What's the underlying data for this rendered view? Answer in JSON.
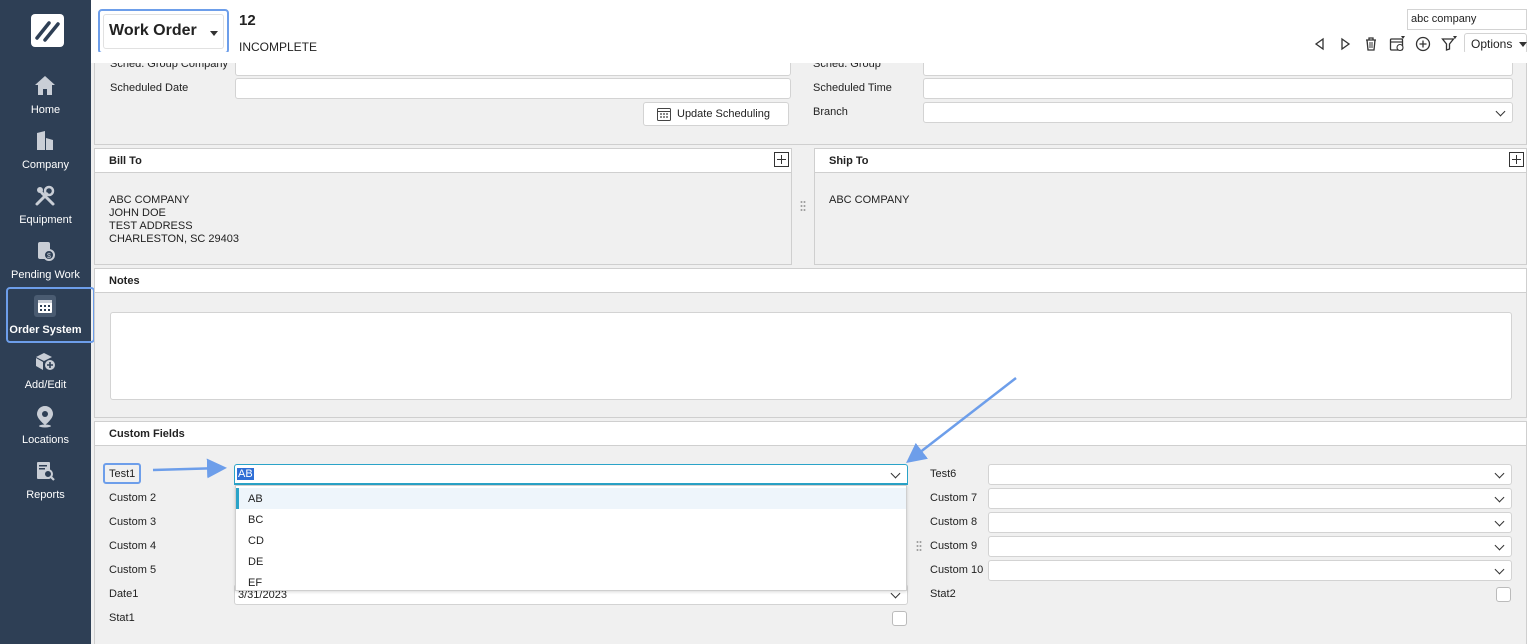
{
  "sidebar": {
    "items": [
      {
        "label": "Home",
        "icon": "home-icon"
      },
      {
        "label": "Company",
        "icon": "building-icon"
      },
      {
        "label": "Equipment",
        "icon": "wrench-icon"
      },
      {
        "label": "Pending Work",
        "icon": "pending-work-icon"
      },
      {
        "label": "Order System",
        "icon": "calendar-icon",
        "active": true
      },
      {
        "label": "Add/Edit",
        "icon": "add-edit-icon"
      },
      {
        "label": "Locations",
        "icon": "location-pin-icon"
      },
      {
        "label": "Reports",
        "icon": "reports-icon"
      }
    ]
  },
  "header": {
    "module": "Work Order",
    "number": "12",
    "status": "INCOMPLETE",
    "company_search": "abc company",
    "options_label": "Options"
  },
  "scheduling": {
    "sched_group_company_label": "Sched. Group Company",
    "scheduled_date_label": "Scheduled Date",
    "sched_group_label": "Sched. Group",
    "scheduled_time_label": "Scheduled Time",
    "branch_label": "Branch",
    "update_button": "Update Scheduling"
  },
  "bill_to": {
    "title": "Bill To",
    "lines": [
      "ABC COMPANY",
      "JOHN DOE",
      "TEST ADDRESS",
      "CHARLESTON, SC 29403"
    ]
  },
  "ship_to": {
    "title": "Ship To",
    "lines": [
      "ABC COMPANY"
    ]
  },
  "notes": {
    "title": "Notes"
  },
  "custom_fields": {
    "title": "Custom Fields",
    "left": [
      {
        "label": "Test1",
        "value": "AB"
      },
      {
        "label": "Custom 2"
      },
      {
        "label": "Custom 3"
      },
      {
        "label": "Custom 4"
      },
      {
        "label": "Custom 5"
      },
      {
        "label": "Date1",
        "value": "3/31/2023"
      },
      {
        "label": "Stat1"
      }
    ],
    "right": [
      {
        "label": "Test6"
      },
      {
        "label": "Custom 7"
      },
      {
        "label": "Custom 8"
      },
      {
        "label": "Custom 9"
      },
      {
        "label": "Custom 10"
      },
      {
        "label": "Stat2"
      }
    ],
    "dropdown_options": [
      "AB",
      "BC",
      "CD",
      "DE",
      "EF"
    ],
    "dropdown_selected": "AB"
  },
  "colors": {
    "sidebar_bg": "#2e3f55",
    "highlight": "#6d9eea",
    "dropdown_accent": "#2aa3c8"
  }
}
